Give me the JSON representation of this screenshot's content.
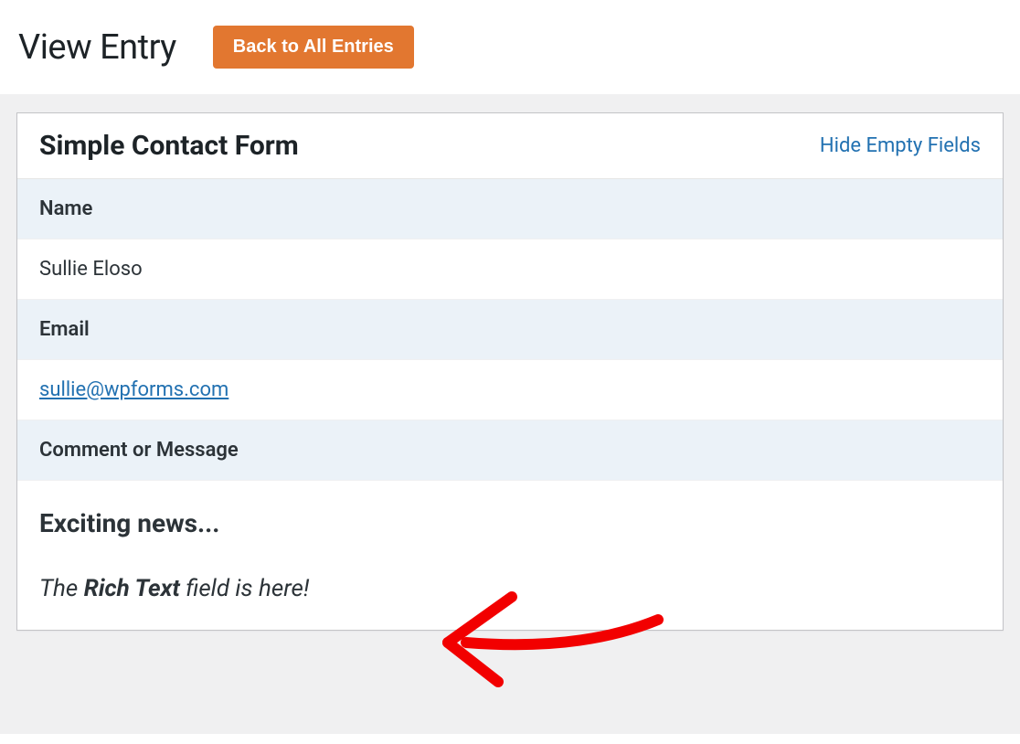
{
  "header": {
    "title": "View Entry",
    "back_button": "Back to All Entries"
  },
  "panel": {
    "form_title": "Simple Contact Form",
    "hide_link": "Hide Empty Fields"
  },
  "fields": {
    "name": {
      "label": "Name",
      "value": "Sullie Eloso"
    },
    "email": {
      "label": "Email",
      "value": "sullie@wpforms.com"
    },
    "message": {
      "label": "Comment or Message",
      "heading": "Exciting news...",
      "line_prefix": "The ",
      "line_bold": "Rich Text",
      "line_suffix": " field is here!"
    }
  }
}
